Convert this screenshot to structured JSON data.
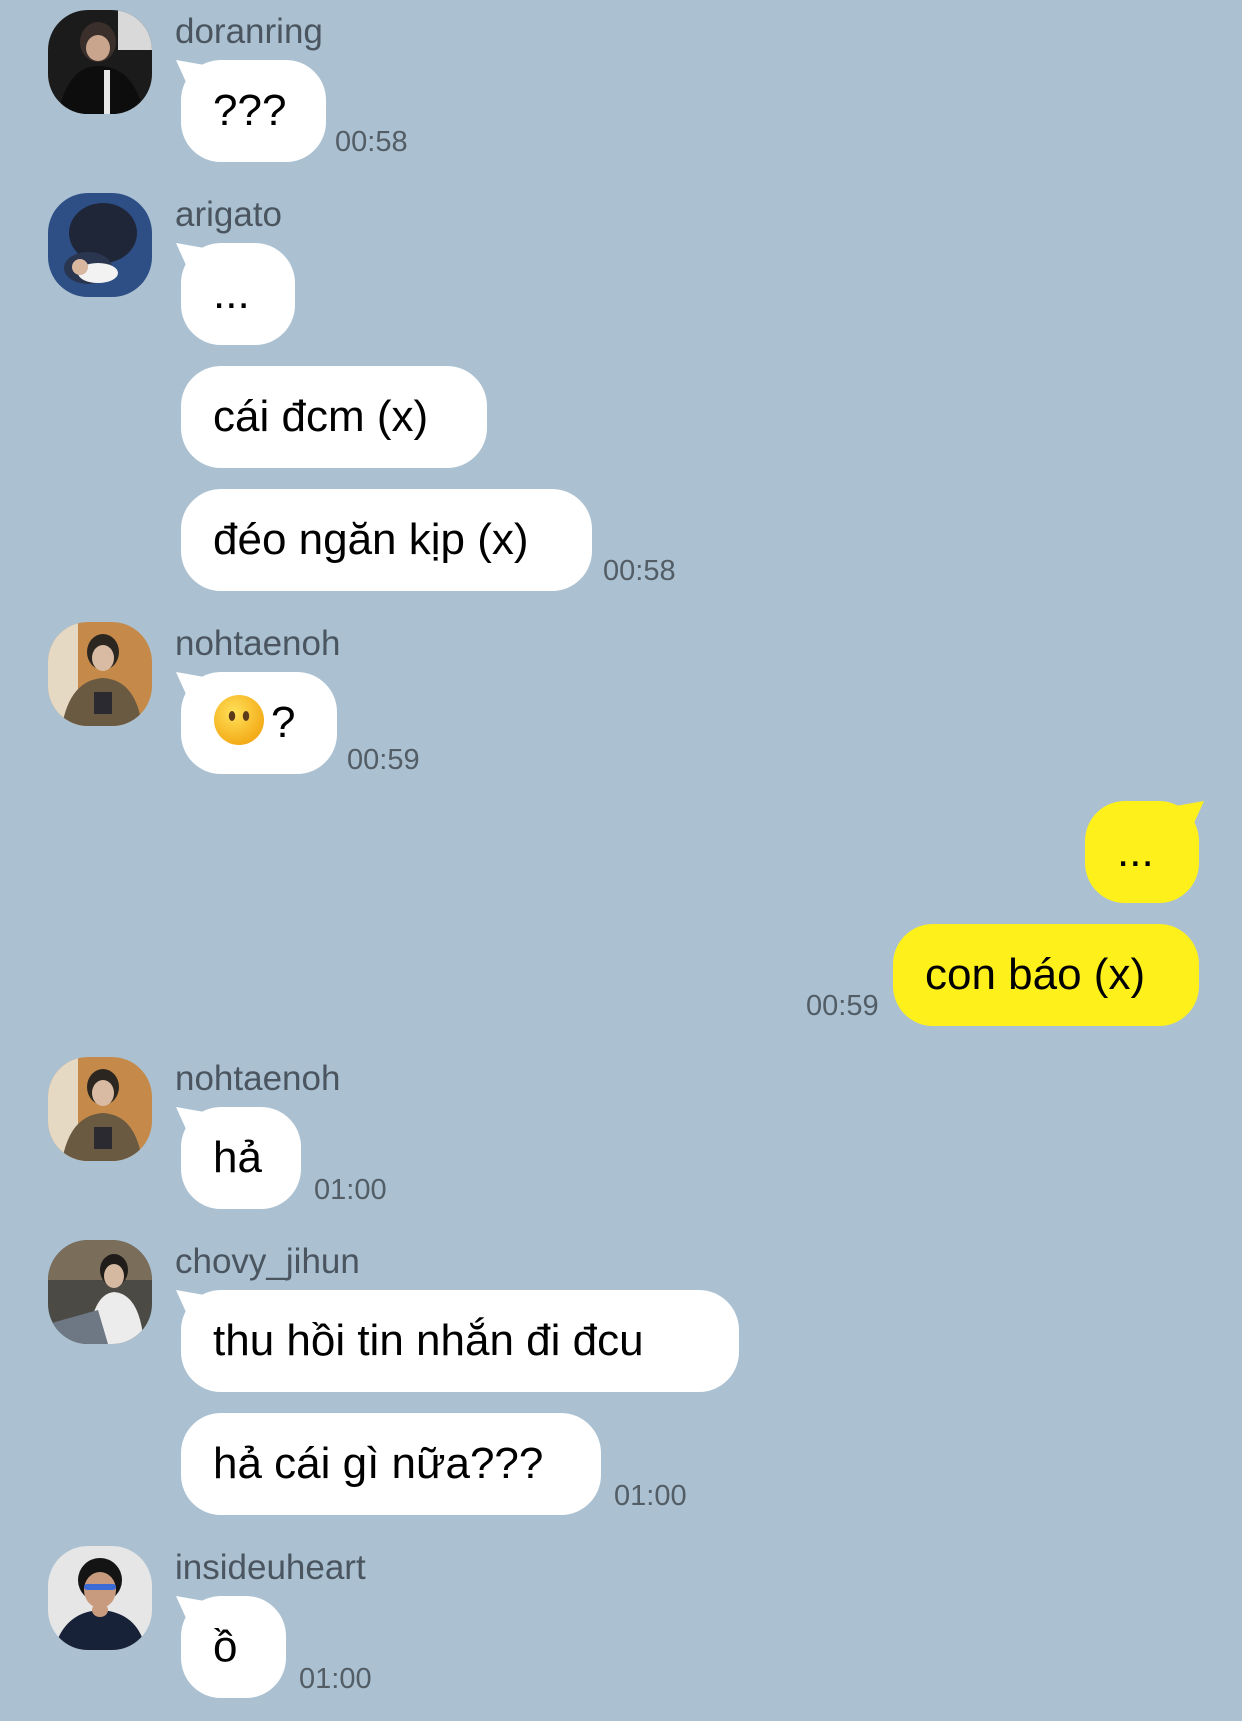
{
  "messages": [
    {
      "sender": "doranring",
      "texts": [
        "???"
      ],
      "time": "00:58"
    },
    {
      "sender": "arigato",
      "texts": [
        "...",
        "cái đcm (x)",
        "đéo ngăn kịp (x)"
      ],
      "time": "00:58"
    },
    {
      "sender": "nohtaenoh",
      "emoji": "face-without-mouth-emoji",
      "texts": [
        "?"
      ],
      "time": "00:59"
    },
    {
      "sender": "me",
      "texts": [
        "...",
        "con báo (x)"
      ],
      "time": "00:59"
    },
    {
      "sender": "nohtaenoh",
      "texts": [
        "hả"
      ],
      "time": "01:00"
    },
    {
      "sender": "chovy_jihun",
      "texts": [
        "thu hồi tin nhắn đi đcu",
        "hả cái gì nữa???"
      ],
      "time": "01:00"
    },
    {
      "sender": "insideuheart",
      "texts": [
        "ồ"
      ],
      "time": "01:00"
    }
  ],
  "colors": {
    "background": "#abc1d1",
    "bubble_other": "#ffffff",
    "bubble_mine": "#fef01b",
    "meta_text": "#535d66"
  }
}
